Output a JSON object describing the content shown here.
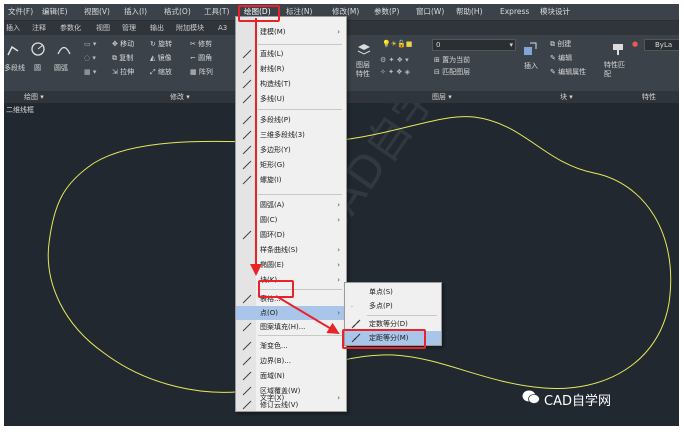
{
  "menubar": {
    "items": [
      "文件(F)",
      "编辑(E)",
      "视图(V)",
      "插入(I)",
      "格式(O)",
      "工具(T)",
      "绘图(D)",
      "标注(N)",
      "修改(M)",
      "参数(P)",
      "窗口(W)",
      "帮助(H)",
      "Express",
      "模块设计"
    ]
  },
  "ribbon_tabs": [
    "插入",
    "注释",
    "参数化",
    "视图",
    "管理",
    "输出",
    "附加模块",
    "A3"
  ],
  "ribbon": {
    "draw_group": [
      "多段线",
      "圆",
      "圆弧"
    ],
    "modify_group": [
      "移动",
      "旋转",
      "修剪",
      "复制",
      "镜像",
      "圆角",
      "拉伸",
      "缩放",
      "阵列"
    ],
    "layer_value": "0",
    "layer_props": "图层特性",
    "layer_actions": [
      "置为当前",
      "匹配图层"
    ],
    "insert_label": "插入",
    "block_actions": [
      "创建",
      "编辑",
      "编辑属性"
    ],
    "match_label": "特性匹配",
    "bylayer": "ByLa"
  },
  "panels": {
    "draw": "绘图",
    "modify": "修改",
    "layers": "图层",
    "block": "块",
    "properties": "特性"
  },
  "viewport_label": "二维线框",
  "draw_menu": {
    "items": [
      {
        "label": "建模(M)",
        "arrow": "›"
      },
      {
        "label": "直线(L)"
      },
      {
        "label": "射线(R)"
      },
      {
        "label": "构造线(T)"
      },
      {
        "label": "多线(U)"
      },
      {
        "label": "多段线(P)"
      },
      {
        "label": "三维多段线(3)"
      },
      {
        "label": "多边形(Y)"
      },
      {
        "label": "矩形(G)"
      },
      {
        "label": "螺旋(I)"
      },
      {
        "label": "圆弧(A)",
        "arrow": "›"
      },
      {
        "label": "圆(C)",
        "arrow": "›"
      },
      {
        "label": "圆环(D)"
      },
      {
        "label": "样条曲线(S)",
        "arrow": "›"
      },
      {
        "label": "椭圆(E)",
        "arrow": "›"
      },
      {
        "label": "块(K)",
        "arrow": "›"
      },
      {
        "label": "表格..."
      },
      {
        "label": "点(O)",
        "arrow": "›"
      },
      {
        "label": "图案填充(H)..."
      },
      {
        "label": "渐变色..."
      },
      {
        "label": "边界(B)..."
      },
      {
        "label": "面域(N)"
      },
      {
        "label": "区域覆盖(W)"
      },
      {
        "label": "修订云线(V)"
      },
      {
        "label": "文字(X)",
        "arrow": "›"
      }
    ]
  },
  "point_submenu": {
    "items": [
      "单点(S)",
      "多点(P)",
      "定数等分(D)",
      "定距等分(M)"
    ]
  },
  "watermark": "CAD自学网",
  "colors": {
    "highlight": "#a9c6ea",
    "annotation": "#e8242a",
    "shape": "#e8e85a"
  }
}
